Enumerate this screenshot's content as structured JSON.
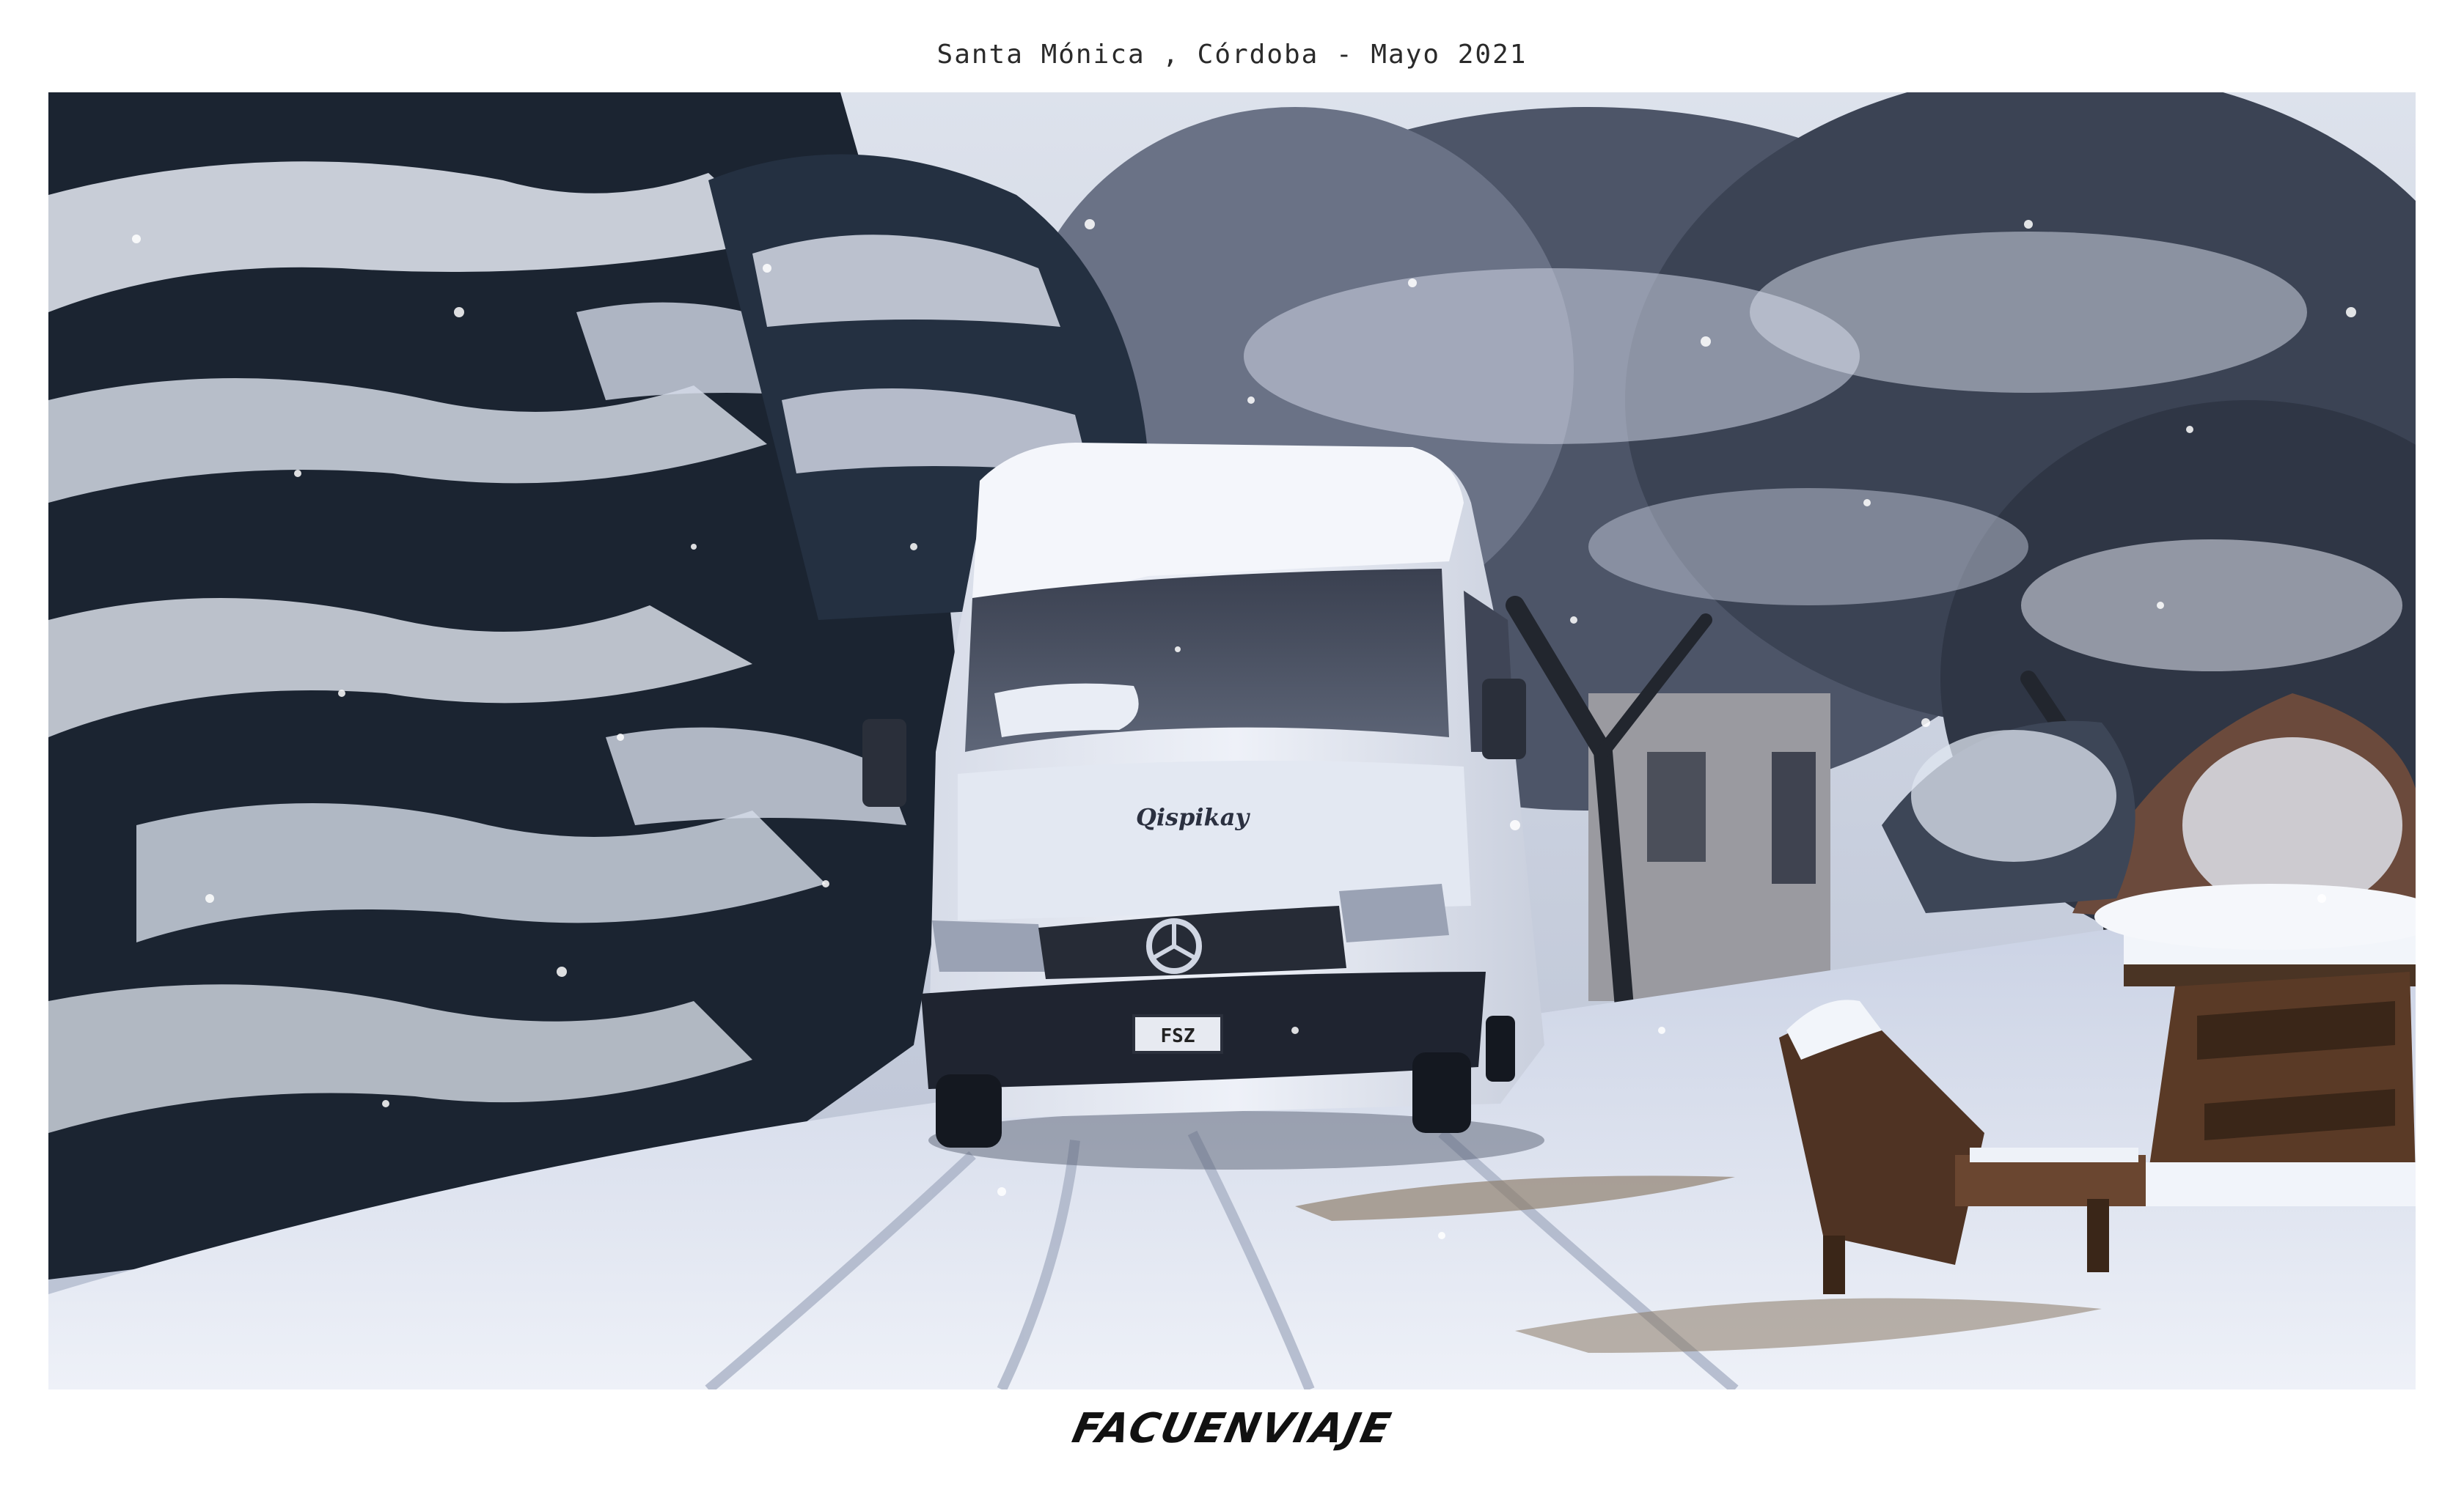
{
  "caption": "Santa Mónica , Córdoba - Mayo 2021",
  "photo": {
    "van_brand": "Qispikay",
    "plate": "FSZ"
  },
  "signature": "FACUENVIAJE",
  "colors": {
    "snow": "#eef1f8",
    "tree_dark": "#1b2431",
    "van_white": "#e9edf6",
    "sky": "#d6dbe6",
    "wood": "#5a3a26"
  }
}
